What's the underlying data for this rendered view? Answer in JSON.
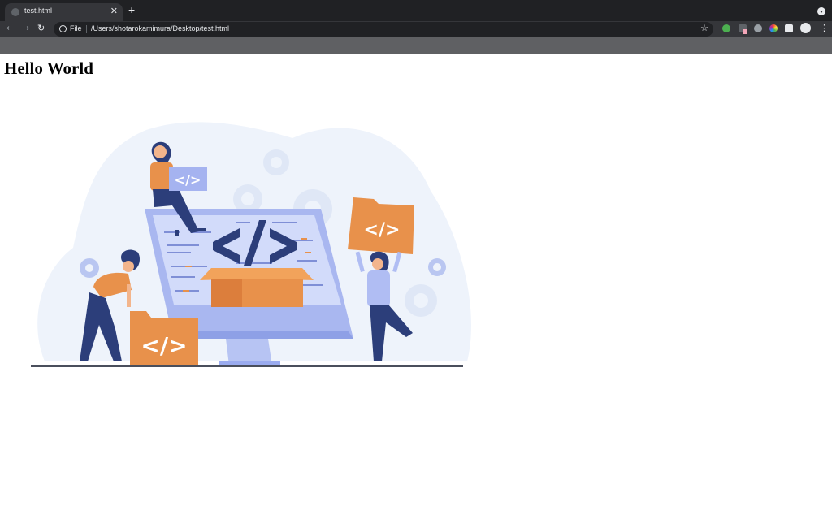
{
  "browser": {
    "tab": {
      "title": "test.html"
    },
    "new_tab_label": "+",
    "toolbar": {
      "back": "←",
      "forward": "→",
      "reload": "↻",
      "scheme_label": "File",
      "url": "/Users/shotarokamimura/Desktop/test.html",
      "bookmark_star": "☆",
      "menu": "⋮"
    },
    "extensions": [
      "evernote-icon",
      "pen-icon",
      "pinterest-icon",
      "color-picker-icon",
      "puzzle-icon",
      "profile-avatar"
    ]
  },
  "page": {
    "heading": "Hello World",
    "illustration": {
      "code_tag": "</>",
      "accent_orange": "#e8914b",
      "accent_navy": "#2c3e7a",
      "accent_lavender": "#a5b3f0",
      "blob": "#eef3fb"
    }
  }
}
